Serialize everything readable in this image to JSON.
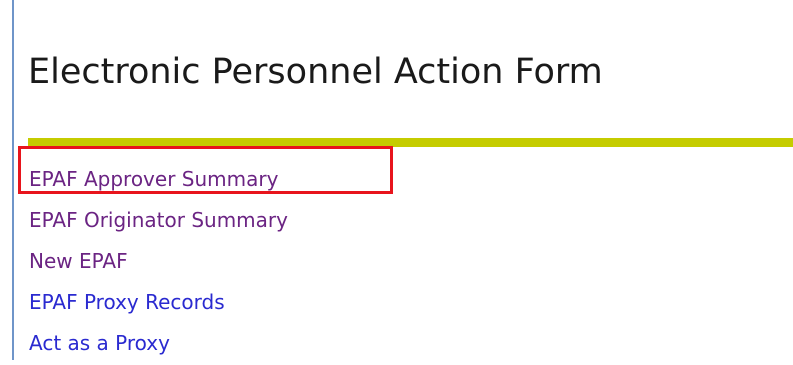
{
  "page": {
    "title": "Electronic Personnel Action Form"
  },
  "menu": {
    "items": [
      {
        "label": "EPAF Approver Summary",
        "state": "visited",
        "highlighted": true
      },
      {
        "label": "EPAF Originator Summary",
        "state": "visited"
      },
      {
        "label": "New EPAF",
        "state": "visited"
      },
      {
        "label": "EPAF Proxy Records",
        "state": "unvisited"
      },
      {
        "label": "Act as a Proxy",
        "state": "unvisited"
      }
    ]
  },
  "colors": {
    "frame_border": "#6f95c9",
    "title_rule": "#c5cc00",
    "visited_link": "#6b2483",
    "unvisited_link": "#2a2ad0",
    "highlight_box": "#e8141c"
  }
}
